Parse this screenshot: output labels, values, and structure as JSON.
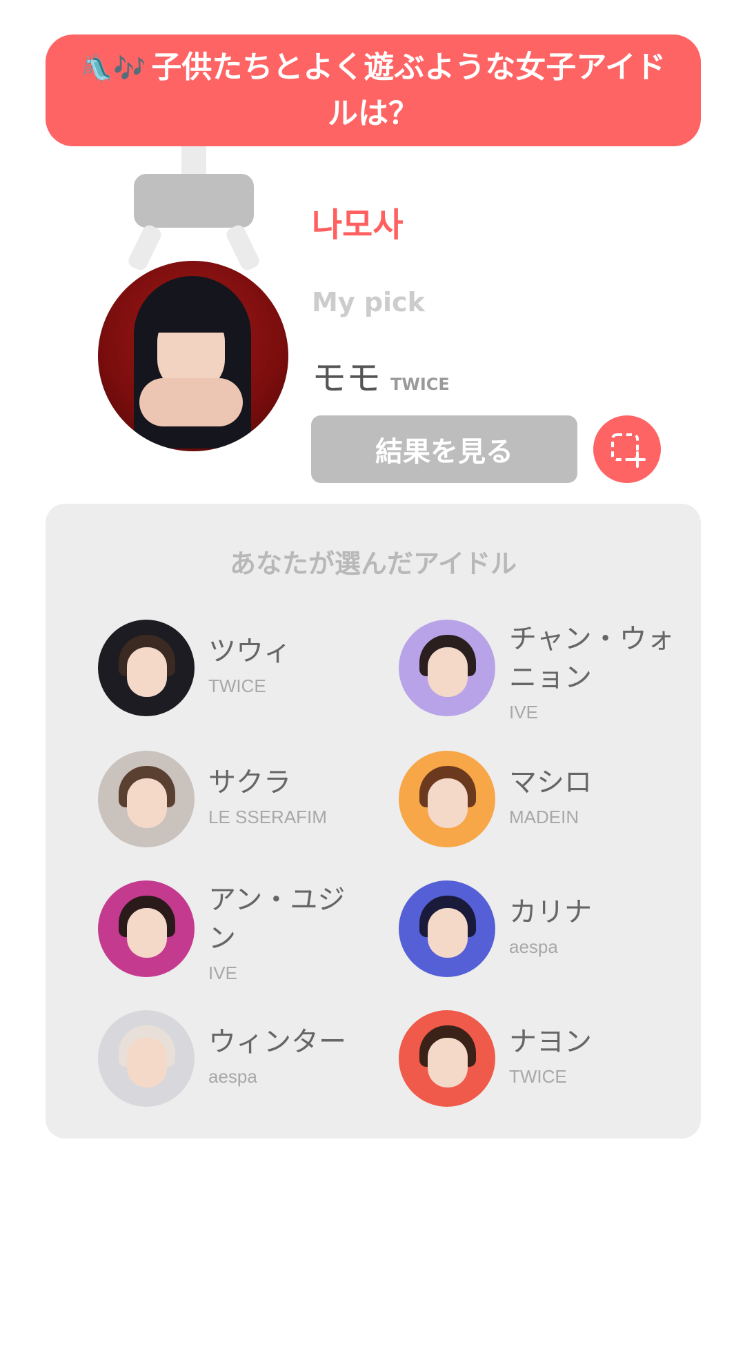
{
  "banner": {
    "icon": "🛝🎶",
    "question": "子供たちとよく遊ぶような女子アイドルは？"
  },
  "profile": {
    "nickname": "나모사",
    "mypick_label": "My pick",
    "pick_name": "モモ",
    "pick_group": "TWICE"
  },
  "actions": {
    "result_button": "結果を見る",
    "capture_icon": "screenshot-capture-icon"
  },
  "chosen": {
    "title": "あなたが選んだアイドル",
    "idols": [
      {
        "name": "ツウィ",
        "group": "TWICE",
        "bg": "#1c1c22",
        "hair": "#3a2a22"
      },
      {
        "name": "チャン・ウォニョン",
        "group": "IVE",
        "bg": "#b9a3e8",
        "hair": "#2a1e1e"
      },
      {
        "name": "サクラ",
        "group": "LE SSERAFIM",
        "bg": "#c9c2bd",
        "hair": "#5a4030"
      },
      {
        "name": "マシロ",
        "group": "MADEIN",
        "bg": "#f7a648",
        "hair": "#6b3a1e"
      },
      {
        "name": "アン・ユジン",
        "group": "IVE",
        "bg": "#c43a8e",
        "hair": "#2a1a1a"
      },
      {
        "name": "カリナ",
        "group": "aespa",
        "bg": "#5560d6",
        "hair": "#1a1a3a"
      },
      {
        "name": "ウィンター",
        "group": "aespa",
        "bg": "#d8d8dc",
        "hair": "#e8e0d8"
      },
      {
        "name": "ナヨン",
        "group": "TWICE",
        "bg": "#ef5a4a",
        "hair": "#3a2218"
      }
    ]
  },
  "colors": {
    "accent": "#ff6464",
    "panel": "#ededed",
    "button_gray": "#bdbdbd"
  }
}
